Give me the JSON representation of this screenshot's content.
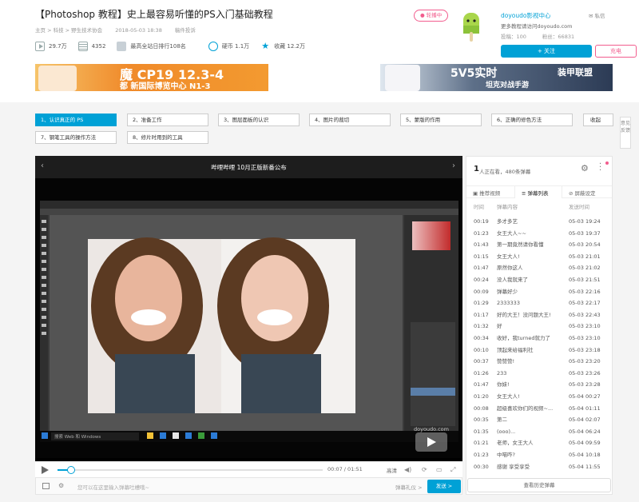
{
  "video": {
    "title": "【Photoshop 教程】史上最容易听懂的PS入门基础教程",
    "breadcrumb": [
      "主页 > 科技 > 野生技术协会",
      "2018-05-03 18:38",
      "稿件投诉"
    ],
    "stats": {
      "plays": "29.7万",
      "danmaku": "4352",
      "rank": "最高全站日排行108名",
      "coins_label": "硬币 1.1万",
      "favorites_label": "收藏 12.2万"
    }
  },
  "live_badge": "轮播中",
  "uploader": {
    "name": "doyoudo影视中心",
    "desc": "更多教程请访问doyoudo.com",
    "submissions": "投稿：100",
    "fans": "粉丝：66831",
    "message": "私信",
    "follow": "+ 关注",
    "charge": "充电"
  },
  "banners": {
    "left_text": "魔  CP19  12.3-4",
    "left_sub": "都  新国际博览中心 N1-3",
    "right_text": "5V5实时",
    "right_sub": "坦克对战手游",
    "right_logo": "装甲联盟"
  },
  "parts": [
    {
      "label": "1、认识真正的 PS",
      "active": true
    },
    {
      "label": "2、准备工作",
      "active": false
    },
    {
      "label": "3、图层面板的认识",
      "active": false
    },
    {
      "label": "4、图片的裁切",
      "active": false
    },
    {
      "label": "5、蒙版的作用",
      "active": false
    },
    {
      "label": "6、正确的修色方法",
      "active": false
    },
    {
      "label": "7、钢笔工具的操作方法",
      "active": false
    },
    {
      "label": "8、修片时用到的工具",
      "active": false
    }
  ],
  "parts_collapse": "收起",
  "side_tab": "意见反馈",
  "player": {
    "notice": "哔哩哔哩 10月正版新番公布",
    "time": "00:07 / 01:51",
    "quality": "高清",
    "progress": 0.05,
    "danmaku_placeholder": "您可以在这里输入弹幕吐槽哦~",
    "danmaku_etiquette": "弹幕礼仪 >",
    "send": "发送 >",
    "windows_search": "搜索 Web 和 Windows",
    "watermark": "doyoudo.com"
  },
  "danmaku_panel": {
    "online": "1",
    "online_label": "人正在看，480条弹幕",
    "tabs": [
      "推荐视频",
      "弹幕列表",
      "屏蔽设定"
    ],
    "headers": [
      "时间",
      "弹幕内容",
      "发送时间"
    ],
    "rows": [
      [
        "00:19",
        "多才多艺",
        "05-03 19:24"
      ],
      [
        "01:23",
        "女王大人~~",
        "05-03 19:37"
      ],
      [
        "01:43",
        "第一期竟然请你看懂",
        "05-03 20:54"
      ],
      [
        "01:15",
        "女王大人!",
        "05-03 21:01"
      ],
      [
        "01:47",
        "原然你这人",
        "05-03 21:02"
      ],
      [
        "00:24",
        "没人我就来了",
        "05-03 21:51"
      ],
      [
        "00:09",
        "弹幕好少",
        "05-03 22:16"
      ],
      [
        "01:29",
        "2333333",
        "05-03 22:17"
      ],
      [
        "01:17",
        "好的大王！没问题大王!",
        "05-03 22:43"
      ],
      [
        "01:32",
        "好",
        "05-03 23:10"
      ],
      [
        "00:34",
        "收好，我turned就力了",
        "05-03 23:10"
      ],
      [
        "00:10",
        "顶起来给福利社",
        "05-03 23:18"
      ],
      [
        "00:37",
        "赞赞赞!",
        "05-03 23:20"
      ],
      [
        "01:26",
        "233",
        "05-03 23:26"
      ],
      [
        "01:47",
        "你妹!",
        "05-03 23:28"
      ],
      [
        "01:20",
        "女王大人!",
        "05-04 00:27"
      ],
      [
        "00:08",
        "超级喜欢你们的视频~...",
        "05-04 01:11"
      ],
      [
        "00:35",
        "第二",
        "05-04 02:07"
      ],
      [
        "01:35",
        "(ooo)...",
        "05-04 06:24"
      ],
      [
        "01:21",
        "老师，女王大人",
        "05-04 09:59"
      ],
      [
        "01:23",
        "中喵咋?",
        "05-04 10:18"
      ],
      [
        "00:30",
        "感谢 享受享受",
        "05-04 11:55"
      ]
    ],
    "history": "查看历史弹幕"
  },
  "colors": {
    "accent": "#00a1d6",
    "pink": "#f25d8e"
  }
}
